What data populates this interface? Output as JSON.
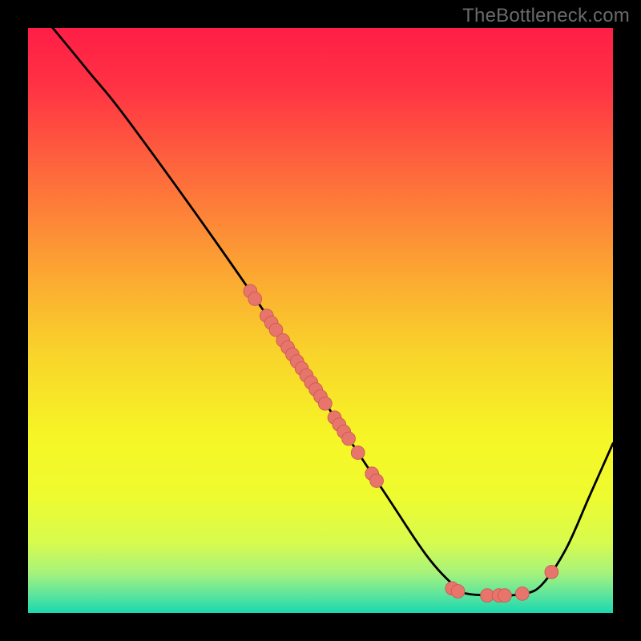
{
  "watermark": "TheBottleneck.com",
  "colors": {
    "frame": "#000000",
    "curve": "#000000",
    "marker_fill": "#E8756B",
    "marker_stroke": "#C95A52",
    "gradient_stops": [
      {
        "offset": 0.0,
        "color": "#FF1E46"
      },
      {
        "offset": 0.1,
        "color": "#FF3244"
      },
      {
        "offset": 0.25,
        "color": "#FE6A3C"
      },
      {
        "offset": 0.4,
        "color": "#FCA033"
      },
      {
        "offset": 0.55,
        "color": "#F9D22B"
      },
      {
        "offset": 0.7,
        "color": "#F6F626"
      },
      {
        "offset": 0.8,
        "color": "#EEFB2F"
      },
      {
        "offset": 0.88,
        "color": "#D7FB4E"
      },
      {
        "offset": 0.93,
        "color": "#A9F37A"
      },
      {
        "offset": 0.97,
        "color": "#5BE49E"
      },
      {
        "offset": 1.0,
        "color": "#19D8AF"
      }
    ]
  },
  "chart_data": {
    "type": "line",
    "title": "",
    "xlabel": "",
    "ylabel": "",
    "xlim": [
      0,
      100
    ],
    "ylim": [
      0,
      100
    ],
    "grid": false,
    "legend": false,
    "curve": [
      {
        "x": 3,
        "y": 101.5
      },
      {
        "x": 10,
        "y": 93
      },
      {
        "x": 18,
        "y": 83
      },
      {
        "x": 38,
        "y": 55
      },
      {
        "x": 60,
        "y": 22
      },
      {
        "x": 68,
        "y": 10
      },
      {
        "x": 73,
        "y": 4.5
      },
      {
        "x": 75,
        "y": 3.3
      },
      {
        "x": 80,
        "y": 3.0
      },
      {
        "x": 85,
        "y": 3.3
      },
      {
        "x": 88,
        "y": 5
      },
      {
        "x": 92,
        "y": 11
      },
      {
        "x": 96,
        "y": 20
      },
      {
        "x": 100,
        "y": 29
      }
    ],
    "markers": [
      {
        "x": 38.0,
        "y": 55.0
      },
      {
        "x": 38.8,
        "y": 53.7
      },
      {
        "x": 40.8,
        "y": 50.8
      },
      {
        "x": 41.6,
        "y": 49.6
      },
      {
        "x": 42.4,
        "y": 48.4
      },
      {
        "x": 43.6,
        "y": 46.6
      },
      {
        "x": 44.4,
        "y": 45.4
      },
      {
        "x": 45.2,
        "y": 44.2
      },
      {
        "x": 46.0,
        "y": 43.0
      },
      {
        "x": 46.8,
        "y": 41.8
      },
      {
        "x": 47.6,
        "y": 40.6
      },
      {
        "x": 48.4,
        "y": 39.4
      },
      {
        "x": 49.2,
        "y": 38.2
      },
      {
        "x": 50.0,
        "y": 37.0
      },
      {
        "x": 50.8,
        "y": 35.8
      },
      {
        "x": 52.4,
        "y": 33.4
      },
      {
        "x": 53.2,
        "y": 32.2
      },
      {
        "x": 54.0,
        "y": 31.0
      },
      {
        "x": 54.8,
        "y": 29.8
      },
      {
        "x": 56.4,
        "y": 27.4
      },
      {
        "x": 58.8,
        "y": 23.8
      },
      {
        "x": 59.6,
        "y": 22.6
      },
      {
        "x": 72.5,
        "y": 4.2
      },
      {
        "x": 73.5,
        "y": 3.7
      },
      {
        "x": 78.5,
        "y": 3.0
      },
      {
        "x": 80.5,
        "y": 3.0
      },
      {
        "x": 81.5,
        "y": 3.0
      },
      {
        "x": 84.5,
        "y": 3.3
      },
      {
        "x": 89.5,
        "y": 7.0
      }
    ]
  }
}
